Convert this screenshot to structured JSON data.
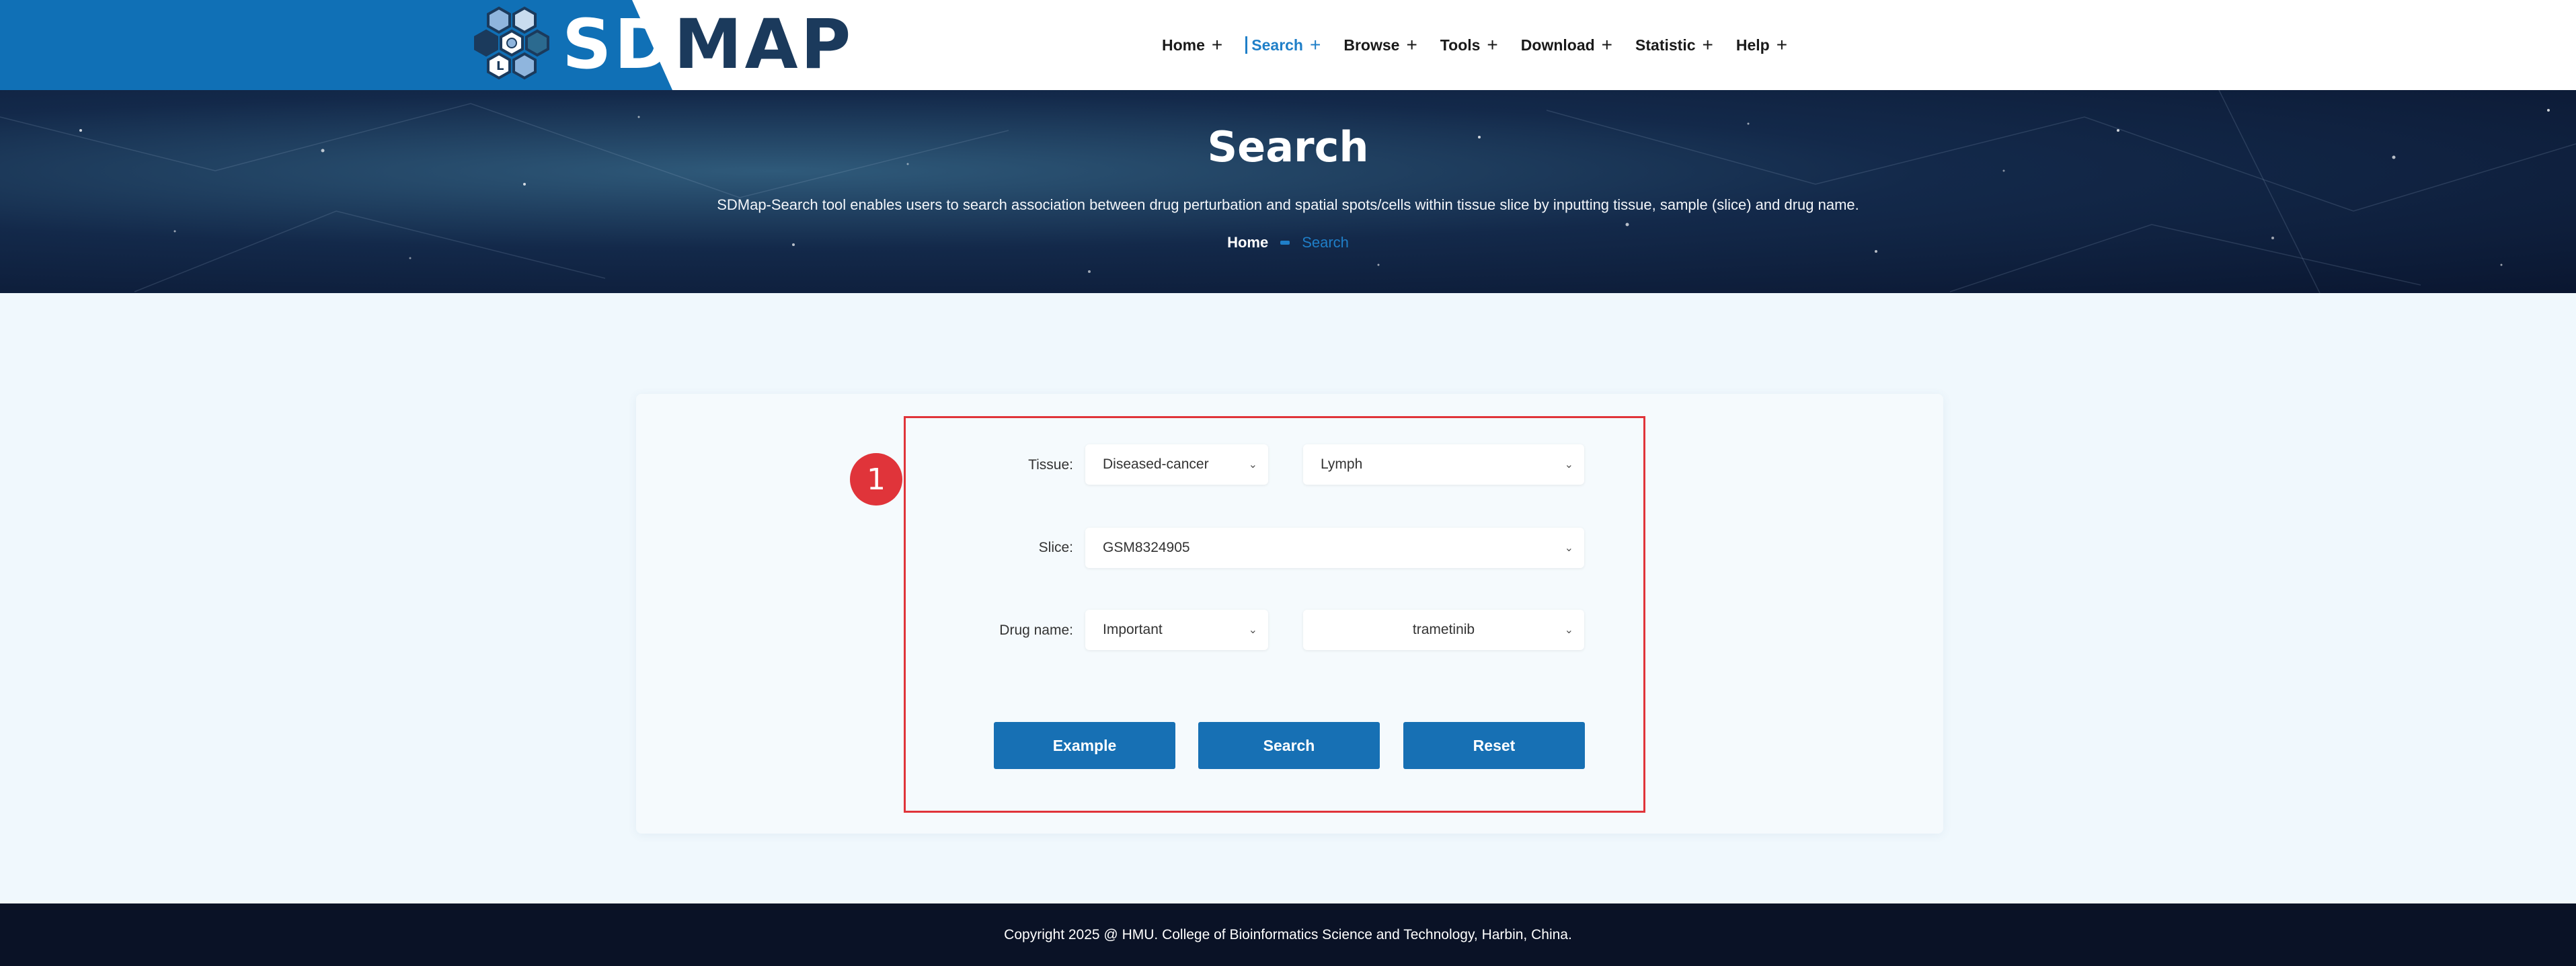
{
  "header": {
    "logo_text_light": "SD",
    "logo_text_dark": "MAP",
    "brand_color": "#1070b6",
    "nav": [
      {
        "label": "Home",
        "expander": "+",
        "active": false
      },
      {
        "label": "Search",
        "expander": "+",
        "active": true
      },
      {
        "label": "Browse",
        "expander": "+",
        "active": false
      },
      {
        "label": "Tools",
        "expander": "+",
        "active": false
      },
      {
        "label": "Download",
        "expander": "+",
        "active": false
      },
      {
        "label": "Statistic",
        "expander": "+",
        "active": false
      },
      {
        "label": "Help",
        "expander": "+",
        "active": false
      }
    ]
  },
  "banner": {
    "title": "Search",
    "description": "SDMap-Search tool enables users to search association between drug perturbation and spatial spots/cells within tissue slice by inputting tissue, sample (slice) and drug name.",
    "breadcrumb": {
      "home": "Home",
      "current": "Search"
    }
  },
  "annotation": {
    "badge": "1",
    "color": "#e0343a"
  },
  "form": {
    "tissue_label": "Tissue:",
    "tissue_type_value": "Diseased-cancer",
    "tissue_value": "Lymph",
    "slice_label": "Slice:",
    "slice_value": "GSM8324905",
    "drug_label": "Drug name:",
    "drug_category_value": "Important",
    "drug_value": "trametinib",
    "chevron": "⌄",
    "example_button": "Example",
    "search_button": "Search",
    "reset_button": "Reset",
    "button_color": "#1770b4"
  },
  "footer": {
    "copyright": "Copyright 2025 @ HMU. College of Bioinformatics Science and Technology, Harbin, China."
  }
}
